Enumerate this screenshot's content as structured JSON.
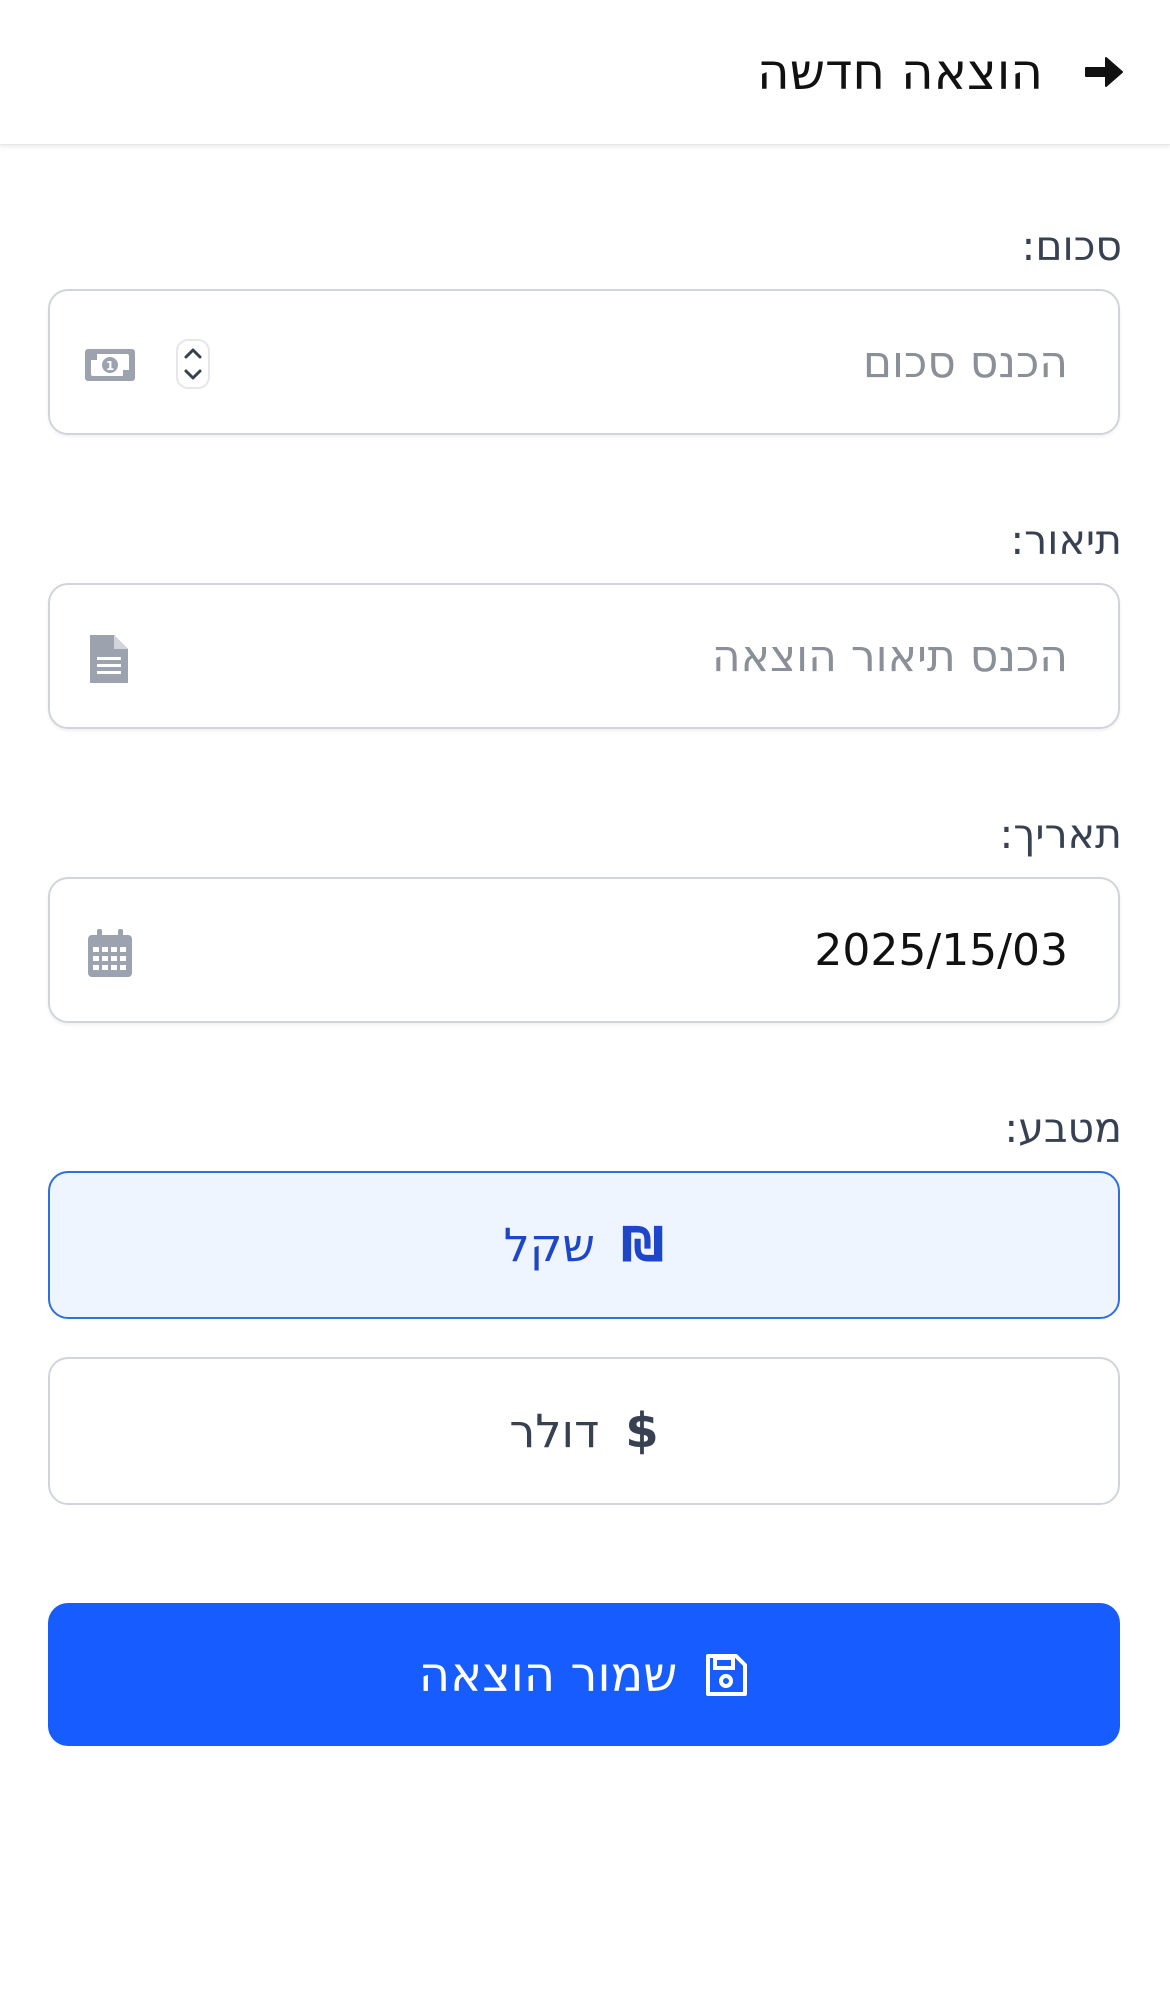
{
  "header": {
    "title": "הוצאה חדשה",
    "back_icon": "arrow-right-icon"
  },
  "form": {
    "amount": {
      "label": "סכום:",
      "placeholder": "הכנס סכום",
      "value": "",
      "icon": "money-bill-icon"
    },
    "description": {
      "label": "תיאור:",
      "placeholder": "הכנס תיאור הוצאה",
      "value": "",
      "icon": "file-lines-icon"
    },
    "date": {
      "label": "תאריך:",
      "value": "2025/15/03",
      "icon": "calendar-icon"
    },
    "currency": {
      "label": "מטבע:",
      "options": [
        {
          "symbol": "₪",
          "label": "שקל",
          "selected": true
        },
        {
          "symbol": "$",
          "label": "דולר",
          "selected": false
        }
      ]
    }
  },
  "actions": {
    "save_label": "שמור הוצאה",
    "save_icon": "floppy-disk-icon"
  },
  "colors": {
    "primary": "#175cff",
    "selected_bg": "#eef5ff",
    "selected_border": "#2f6fe0",
    "icon_gray": "#9ca3af"
  }
}
